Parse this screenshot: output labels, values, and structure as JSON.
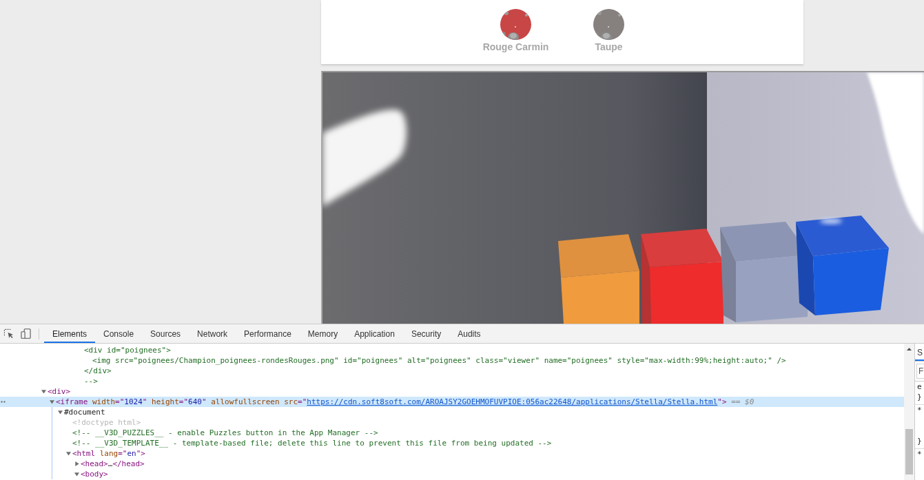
{
  "swatches": [
    {
      "label": "Rouge Carmin",
      "color": "#c84646"
    },
    {
      "label": "Taupe",
      "color": "#86807f"
    }
  ],
  "devtools": {
    "tabs": [
      {
        "label": "Elements",
        "selected": true
      },
      {
        "label": "Console",
        "selected": false
      },
      {
        "label": "Sources",
        "selected": false
      },
      {
        "label": "Network",
        "selected": false
      },
      {
        "label": "Performance",
        "selected": false
      },
      {
        "label": "Memory",
        "selected": false
      },
      {
        "label": "Application",
        "selected": false
      },
      {
        "label": "Security",
        "selected": false
      },
      {
        "label": "Audits",
        "selected": false
      }
    ],
    "dom_tree": [
      {
        "kind": "comment_line",
        "text": "<div id=\"poignees\">",
        "selected": false,
        "children": [
          {
            "kind": "comment_line",
            "text": "<img src=\"poignees/Champion_poignees-rondesRouges.png\" id=\"poignees\" alt=\"poignees\" class=\"viewer\" name=\"poignees\" style=\"max-width:99%;height:auto;\" />",
            "selected": false
          }
        ]
      },
      {
        "kind": "comment_line",
        "text": "</div>",
        "selected": false
      },
      {
        "kind": "comment_line",
        "text": "-->",
        "selected": false
      },
      {
        "kind": "element",
        "tokens": [
          {
            "kind": "tag",
            "text": "<div>"
          }
        ],
        "expanded": true,
        "selected": false,
        "children": [
          {
            "kind": "element",
            "tokens": [
              {
                "kind": "tag",
                "text": "<iframe"
              },
              {
                "kind": "attr",
                "text": " width"
              },
              {
                "kind": "tag",
                "text": "=\""
              },
              {
                "kind": "value",
                "text": "1024"
              },
              {
                "kind": "tag",
                "text": "\""
              },
              {
                "kind": "attr",
                "text": " height"
              },
              {
                "kind": "tag",
                "text": "=\""
              },
              {
                "kind": "value",
                "text": "640"
              },
              {
                "kind": "tag",
                "text": "\""
              },
              {
                "kind": "attr",
                "text": " allowfullscreen src"
              },
              {
                "kind": "tag",
                "text": "=\""
              },
              {
                "kind": "link",
                "text": "https://cdn.soft8soft.com/AROAJSY2GOEHMOFUVPIOE:056ac22648/applications/Stella/Stella.html"
              },
              {
                "kind": "tag",
                "text": "\">"
              },
              {
                "kind": "hint",
                "text": " == $0"
              }
            ],
            "expanded": true,
            "selected": true,
            "children": [
              {
                "kind": "document",
                "text": "#document",
                "expanded": true,
                "selected": false,
                "children": [
                  {
                    "kind": "doctype",
                    "text": "<!doctype html>",
                    "selected": false
                  },
                  {
                    "kind": "comment",
                    "text": "<!-- __V3D_PUZZLES__ - enable Puzzles button in the App Manager -->",
                    "selected": false
                  },
                  {
                    "kind": "comment",
                    "text": "<!-- __V3D_TEMPLATE__ - template-based file; delete this line to prevent this file from being updated -->",
                    "selected": false
                  },
                  {
                    "kind": "element",
                    "tokens": [
                      {
                        "kind": "tag",
                        "text": "<html"
                      },
                      {
                        "kind": "attr",
                        "text": " lang"
                      },
                      {
                        "kind": "tag",
                        "text": "=\""
                      },
                      {
                        "kind": "value",
                        "text": "en"
                      },
                      {
                        "kind": "tag",
                        "text": "\">"
                      }
                    ],
                    "expanded": true,
                    "selected": false,
                    "children": [
                      {
                        "kind": "element",
                        "tokens": [
                          {
                            "kind": "tag",
                            "text": "<head>"
                          },
                          {
                            "kind": "text",
                            "text": "…"
                          },
                          {
                            "kind": "tag",
                            "text": "</head>"
                          }
                        ],
                        "expanded": false,
                        "selected": false
                      },
                      {
                        "kind": "element",
                        "tokens": [
                          {
                            "kind": "tag",
                            "text": "<body>"
                          }
                        ],
                        "expanded": true,
                        "selected": false
                      }
                    ]
                  }
                ]
              }
            ]
          }
        ]
      }
    ],
    "styles_pane": {
      "tabs": [
        {
          "label": "S",
          "selected": true
        }
      ],
      "filter": {
        "placeholder": "F"
      },
      "rules": [
        {
          "kind": "empty",
          "selector": "e",
          "close": "}"
        },
        {
          "kind": "with_properties",
          "selector": "*",
          "close": "}"
        },
        {
          "kind": "with_properties",
          "selector": "*"
        }
      ]
    }
  }
}
